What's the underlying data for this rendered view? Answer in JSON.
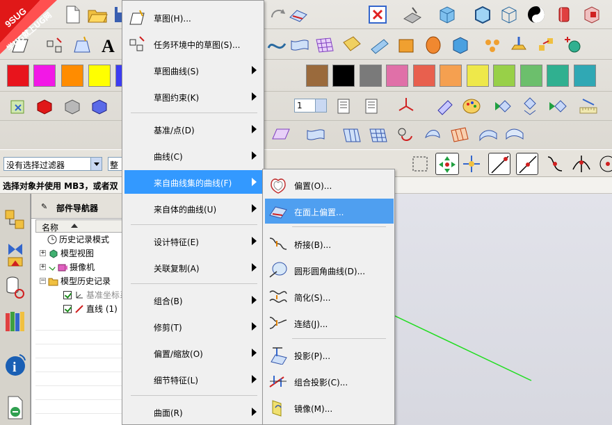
{
  "logo": {
    "text_top": "9SUG",
    "text_bottom": "学UG就上UG网"
  },
  "toolbar": {
    "colors": [
      "#e8141c",
      "#f218e6",
      "#ff8c00",
      "#ffff00",
      "#3c3cf2",
      "#7b3cc8",
      "#9a6a3c",
      "#000000",
      "#7a7a7a",
      "#e070a8",
      "#e8604e",
      "#f5a050",
      "#eee84a",
      "#98d048",
      "#6cbf6c",
      "#30b090",
      "#30a8b4"
    ],
    "layer_combo": "1"
  },
  "filter_bar": {
    "filter_value": "没有选择过滤器",
    "scope_value": "整个"
  },
  "status": {
    "text": "选择对象并使用 MB3，或者双"
  },
  "navigator": {
    "title": "部件导航器",
    "column_header": "名称",
    "items": [
      {
        "label": "历史记录模式"
      },
      {
        "label": "模型视图"
      },
      {
        "label": "摄像机"
      },
      {
        "label": "模型历史记录"
      },
      {
        "label": "基准坐标系"
      },
      {
        "label": "直线 (1)"
      }
    ]
  },
  "menu": {
    "items": [
      {
        "label": "草图(H)..."
      },
      {
        "label": "任务环境中的草图(S)..."
      },
      {
        "label": "草图曲线(S)"
      },
      {
        "label": "草图约束(K)"
      },
      {
        "label": "基准/点(D)"
      },
      {
        "label": "曲线(C)"
      },
      {
        "label": "来自曲线集的曲线(F)"
      },
      {
        "label": "来自体的曲线(U)"
      },
      {
        "label": "设计特征(E)"
      },
      {
        "label": "关联复制(A)"
      },
      {
        "label": "组合(B)"
      },
      {
        "label": "修剪(T)"
      },
      {
        "label": "偏置/缩放(O)"
      },
      {
        "label": "细节特征(L)"
      },
      {
        "label": "曲面(R)"
      }
    ]
  },
  "submenu": {
    "items": [
      {
        "label": "偏置(O)..."
      },
      {
        "label": "在面上偏置..."
      },
      {
        "label": "桥接(B)..."
      },
      {
        "label": "圆形圆角曲线(D)..."
      },
      {
        "label": "简化(S)..."
      },
      {
        "label": "连结(J)..."
      },
      {
        "label": "投影(P)..."
      },
      {
        "label": "组合投影(C)..."
      },
      {
        "label": "镜像(M)..."
      }
    ]
  },
  "colors": {
    "highlight": "#3399ff",
    "submenu_highlight": "#4f9ff0",
    "viewport_line": "#22dd22"
  }
}
